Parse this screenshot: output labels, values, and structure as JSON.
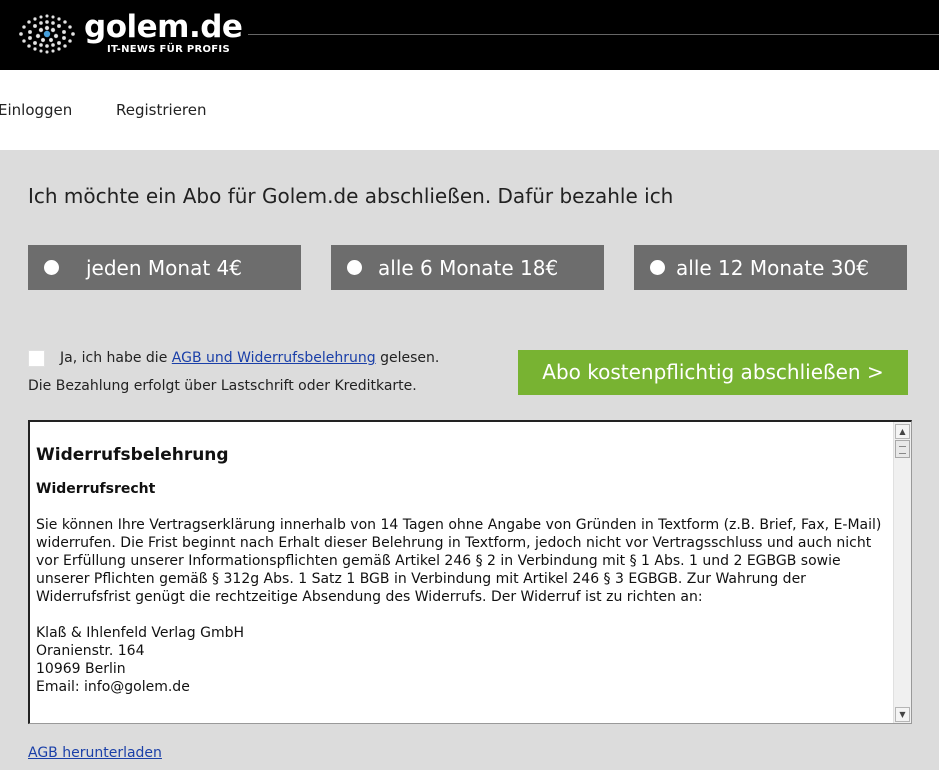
{
  "header": {
    "brand": "golem.de",
    "tagline": "IT-NEWS FÜR PROFIS",
    "logo_icon": "golem-dot-logo"
  },
  "nav": {
    "login": "Einloggen",
    "register": "Registrieren"
  },
  "main": {
    "heading": "Ich möchte ein Abo für Golem.de abschließen. Dafür bezahle ich",
    "plans": [
      {
        "label": "jeden Monat 4€"
      },
      {
        "label": "alle 6 Monate 18€"
      },
      {
        "label": "alle 12 Monate 30€"
      }
    ],
    "agree_prefix": "Ja, ich habe die ",
    "agree_link": "AGB und Widerrufsbelehrung",
    "agree_suffix": " gelesen.",
    "payment_note": "Die Bezahlung erfolgt über Lastschrift oder Kreditkarte.",
    "submit_label": "Abo kostenpflichtig abschließen >"
  },
  "terms": {
    "title": "Widerrufsbelehrung",
    "subtitle": "Widerrufsrecht",
    "paragraph": "Sie können Ihre Vertragserklärung innerhalb von 14 Tagen ohne Angabe von Gründen in Textform (z.B. Brief, Fax, E-Mail) widerrufen. Die Frist beginnt nach Erhalt dieser Belehrung in Textform, jedoch nicht vor Vertragsschluss und auch nicht vor Erfüllung unserer Informationspflichten gemäß Artikel 246 § 2 in Verbindung mit § 1 Abs. 1 und 2 EGBGB sowie unserer Pflichten gemäß § 312g Abs. 1 Satz 1 BGB in Verbindung mit Artikel 246 § 3 EGBGB. Zur Wahrung der Widerrufsfrist genügt die rechtzeitige Absendung des Widerrufs. Der Widerruf ist zu richten an:",
    "address": [
      "Klaß & Ihlenfeld Verlag GmbH",
      "Oranienstr. 164",
      "10969 Berlin",
      "Email: info@golem.de"
    ]
  },
  "footer": {
    "download_link": "AGB herunterladen"
  },
  "colors": {
    "header_bg": "#000000",
    "plan_bg": "#6d6d6d",
    "submit_bg": "#78b332",
    "link": "#1a3fa8",
    "page_bg": "#dcdcdc"
  }
}
